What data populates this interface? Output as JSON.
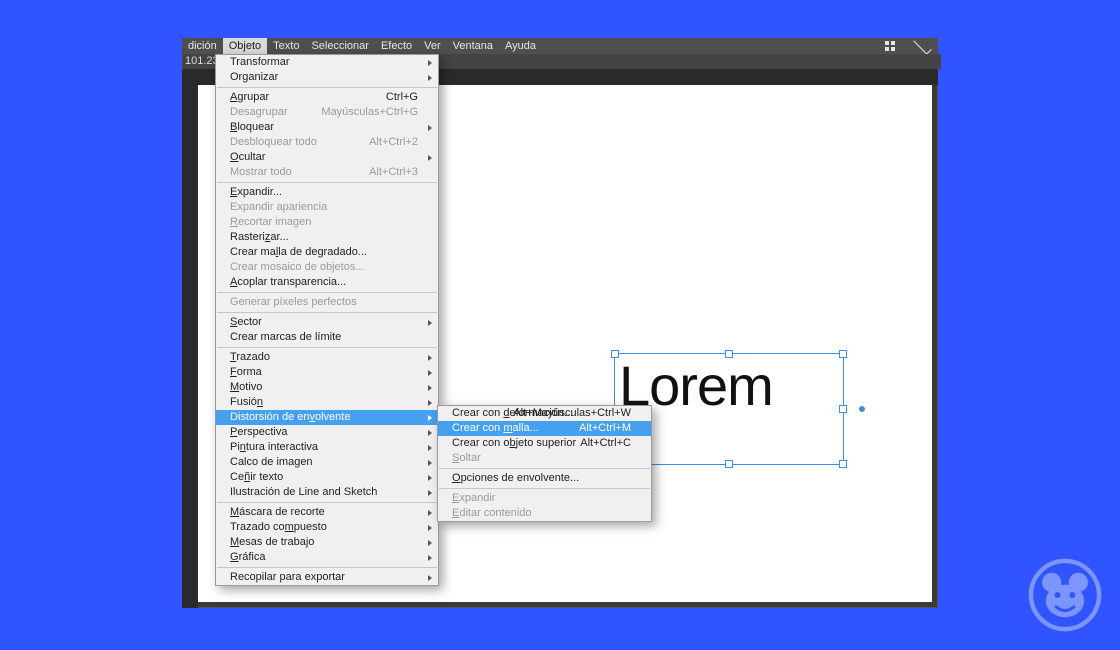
{
  "menubar": {
    "items_left": [
      "dición",
      "Objeto",
      "Texto",
      "Seleccionar",
      "Efecto",
      "Ver",
      "Ventana",
      "Ayuda"
    ],
    "active_index": 1
  },
  "ribbon": {
    "text": "101.23"
  },
  "canvas": {
    "text_object": "Lorem"
  },
  "main_menu": {
    "groups": [
      [
        {
          "label": "Transformar",
          "submenu": true
        },
        {
          "label": "Organizar",
          "submenu": true
        }
      ],
      [
        {
          "label_u": "A",
          "label": "grupar",
          "shortcut": "Ctrl+G"
        },
        {
          "label": "Desagrupar",
          "shortcut": "Mayúsculas+Ctrl+G",
          "disabled": true
        },
        {
          "label_u": "B",
          "label": "loquear",
          "submenu": true
        },
        {
          "label": "Desbloquear todo",
          "shortcut": "Alt+Ctrl+2",
          "disabled": true
        },
        {
          "label_u": "O",
          "label": "cultar",
          "submenu": true
        },
        {
          "label": "Mostrar todo",
          "shortcut": "Alt+Ctrl+3",
          "disabled": true
        }
      ],
      [
        {
          "label_u": "E",
          "label": "xpandir..."
        },
        {
          "label": "Expandir apariencia",
          "disabled": true
        },
        {
          "label_u": "R",
          "label": "ecortar imagen",
          "disabled": true
        },
        {
          "label": "Rasteri",
          "label_u2": "z",
          "label2": "ar..."
        },
        {
          "label": "Crear ma",
          "label_u2": "l",
          "label2": "la de degradado..."
        },
        {
          "label": "Crear mosaico de objetos...",
          "disabled": true
        },
        {
          "label_u": "A",
          "label": "coplar transparencia..."
        }
      ],
      [
        {
          "label": "Generar píxeles perfectos",
          "disabled": true
        }
      ],
      [
        {
          "label_u": "S",
          "label": "ector",
          "submenu": true
        },
        {
          "label": "Crear marcas de límite"
        }
      ],
      [
        {
          "label_u": "T",
          "label": "razado",
          "submenu": true
        },
        {
          "label_u": "F",
          "label": "orma",
          "submenu": true
        },
        {
          "label_u": "M",
          "label": "otivo",
          "submenu": true
        },
        {
          "label": "Fusió",
          "label_u2": "n",
          "label2": "",
          "submenu": true
        },
        {
          "label": "Distorsión de en",
          "label_u2": "v",
          "label2": "olvente",
          "submenu": true,
          "highlight": true
        },
        {
          "label_u": "P",
          "label": "erspectiva",
          "submenu": true
        },
        {
          "label": "Pi",
          "label_u2": "n",
          "label2": "tura interactiva",
          "submenu": true
        },
        {
          "label": "Calco de imagen",
          "submenu": true
        },
        {
          "label": "Ce",
          "label_u2": "ñ",
          "label2": "ir texto",
          "submenu": true
        },
        {
          "label": "Ilustración de Line and Sketch",
          "submenu": true
        }
      ],
      [
        {
          "label_u": "M",
          "label": "áscara de recorte",
          "submenu": true
        },
        {
          "label": "Trazado co",
          "label_u2": "m",
          "label2": "puesto",
          "submenu": true
        },
        {
          "label_u": "M",
          "label": "esas de trabajo",
          "submenu": true
        },
        {
          "label_u": "G",
          "label": "ráfica",
          "submenu": true
        }
      ],
      [
        {
          "label": "Recopilar para exportar",
          "submenu": true
        }
      ]
    ]
  },
  "sub_menu": {
    "groups": [
      [
        {
          "label": "Crear con ",
          "label_u2": "d",
          "label2": "eformación...",
          "shortcut": "Alt+Mayúsculas+Ctrl+W"
        },
        {
          "label": "Crear con ",
          "label_u2": "m",
          "label2": "alla...",
          "shortcut": "Alt+Ctrl+M",
          "highlight": true
        },
        {
          "label": "Crear con o",
          "label_u2": "b",
          "label2": "jeto superior",
          "shortcut": "Alt+Ctrl+C"
        },
        {
          "label_u": "S",
          "label": "oltar",
          "disabled": true
        }
      ],
      [
        {
          "label_u": "O",
          "label": "pciones de envolvente..."
        }
      ],
      [
        {
          "label_u": "E",
          "label": "xpandir",
          "disabled": true
        },
        {
          "label_u": "E",
          "label": "ditar contenido",
          "disabled": true
        }
      ]
    ]
  }
}
